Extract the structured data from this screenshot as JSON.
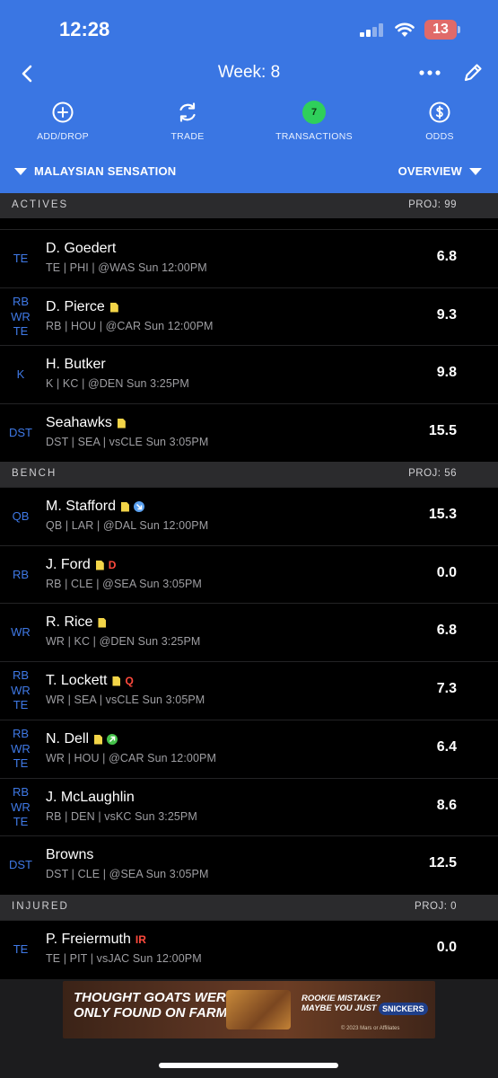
{
  "status_bar": {
    "time": "12:28",
    "battery": "13"
  },
  "header": {
    "title": "Week: 8",
    "actions": [
      {
        "label": "ADD/DROP",
        "icon": "plus-circle-icon"
      },
      {
        "label": "TRADE",
        "icon": "refresh-icon"
      },
      {
        "label": "TRANSACTIONS",
        "badge": "7"
      },
      {
        "label": "ODDS",
        "icon": "dollar-circle-icon"
      }
    ],
    "team": "MALAYSIAN SENSATION",
    "view": "OVERVIEW"
  },
  "sections": [
    {
      "name": "ACTIVES",
      "proj": "PROJ: 99",
      "rows": [
        {
          "pos": [
            "TE"
          ],
          "name": "D. Goedert",
          "sub": "TE | PHI | @WAS Sun 12:00PM",
          "pts": "6.8"
        },
        {
          "pos": [
            "RB",
            "WR",
            "TE"
          ],
          "name": "D. Pierce",
          "note": true,
          "sub": "RB | HOU | @CAR Sun 12:00PM",
          "pts": "9.3"
        },
        {
          "pos": [
            "K"
          ],
          "name": "H. Butker",
          "sub": "K | KC | @DEN Sun 3:25PM",
          "pts": "9.8"
        },
        {
          "pos": [
            "DST"
          ],
          "name": "Seahawks",
          "note": true,
          "sub": "DST | SEA | vsCLE Sun 3:05PM",
          "pts": "15.5"
        }
      ]
    },
    {
      "name": "BENCH",
      "proj": "PROJ: 56",
      "rows": [
        {
          "pos": [
            "QB"
          ],
          "name": "M. Stafford",
          "note": true,
          "trend": "down",
          "sub": "QB | LAR | @DAL Sun 12:00PM",
          "pts": "15.3"
        },
        {
          "pos": [
            "RB"
          ],
          "name": "J. Ford",
          "note": true,
          "tag": "D",
          "sub": "RB | CLE | @SEA Sun 3:05PM",
          "pts": "0.0"
        },
        {
          "pos": [
            "WR"
          ],
          "name": "R. Rice",
          "note": true,
          "sub": "WR | KC | @DEN Sun 3:25PM",
          "pts": "6.8"
        },
        {
          "pos": [
            "RB",
            "WR",
            "TE"
          ],
          "name": "T. Lockett",
          "note": true,
          "tag": "Q",
          "sub": "WR | SEA | vsCLE Sun 3:05PM",
          "pts": "7.3"
        },
        {
          "pos": [
            "RB",
            "WR",
            "TE"
          ],
          "name": "N. Dell",
          "note": true,
          "trend": "up",
          "sub": "WR | HOU | @CAR Sun 12:00PM",
          "pts": "6.4"
        },
        {
          "pos": [
            "RB",
            "WR",
            "TE"
          ],
          "name": "J. McLaughlin",
          "sub": "RB | DEN | vsKC Sun 3:25PM",
          "pts": "8.6"
        },
        {
          "pos": [
            "DST"
          ],
          "name": "Browns",
          "sub": "DST | CLE | @SEA Sun 3:05PM",
          "pts": "12.5"
        }
      ]
    },
    {
      "name": "INJURED",
      "proj": "PROJ: 0",
      "rows": [
        {
          "pos": [
            "TE"
          ],
          "name": "P. Freiermuth",
          "tag": "IR",
          "sub": "TE | PIT | vsJAC Sun 12:00PM",
          "pts": "0.0"
        }
      ]
    }
  ],
  "ad": {
    "left_text": [
      "THOUGHT GOATS WERE",
      "ONLY FOUND ON FARMS?"
    ],
    "right_text": [
      "ROOKIE MISTAKE?",
      "MAYBE YOU JUST NEED A"
    ],
    "brand": "SNICKERS",
    "fine_print": "© 2023 Mars or Affiliates"
  }
}
